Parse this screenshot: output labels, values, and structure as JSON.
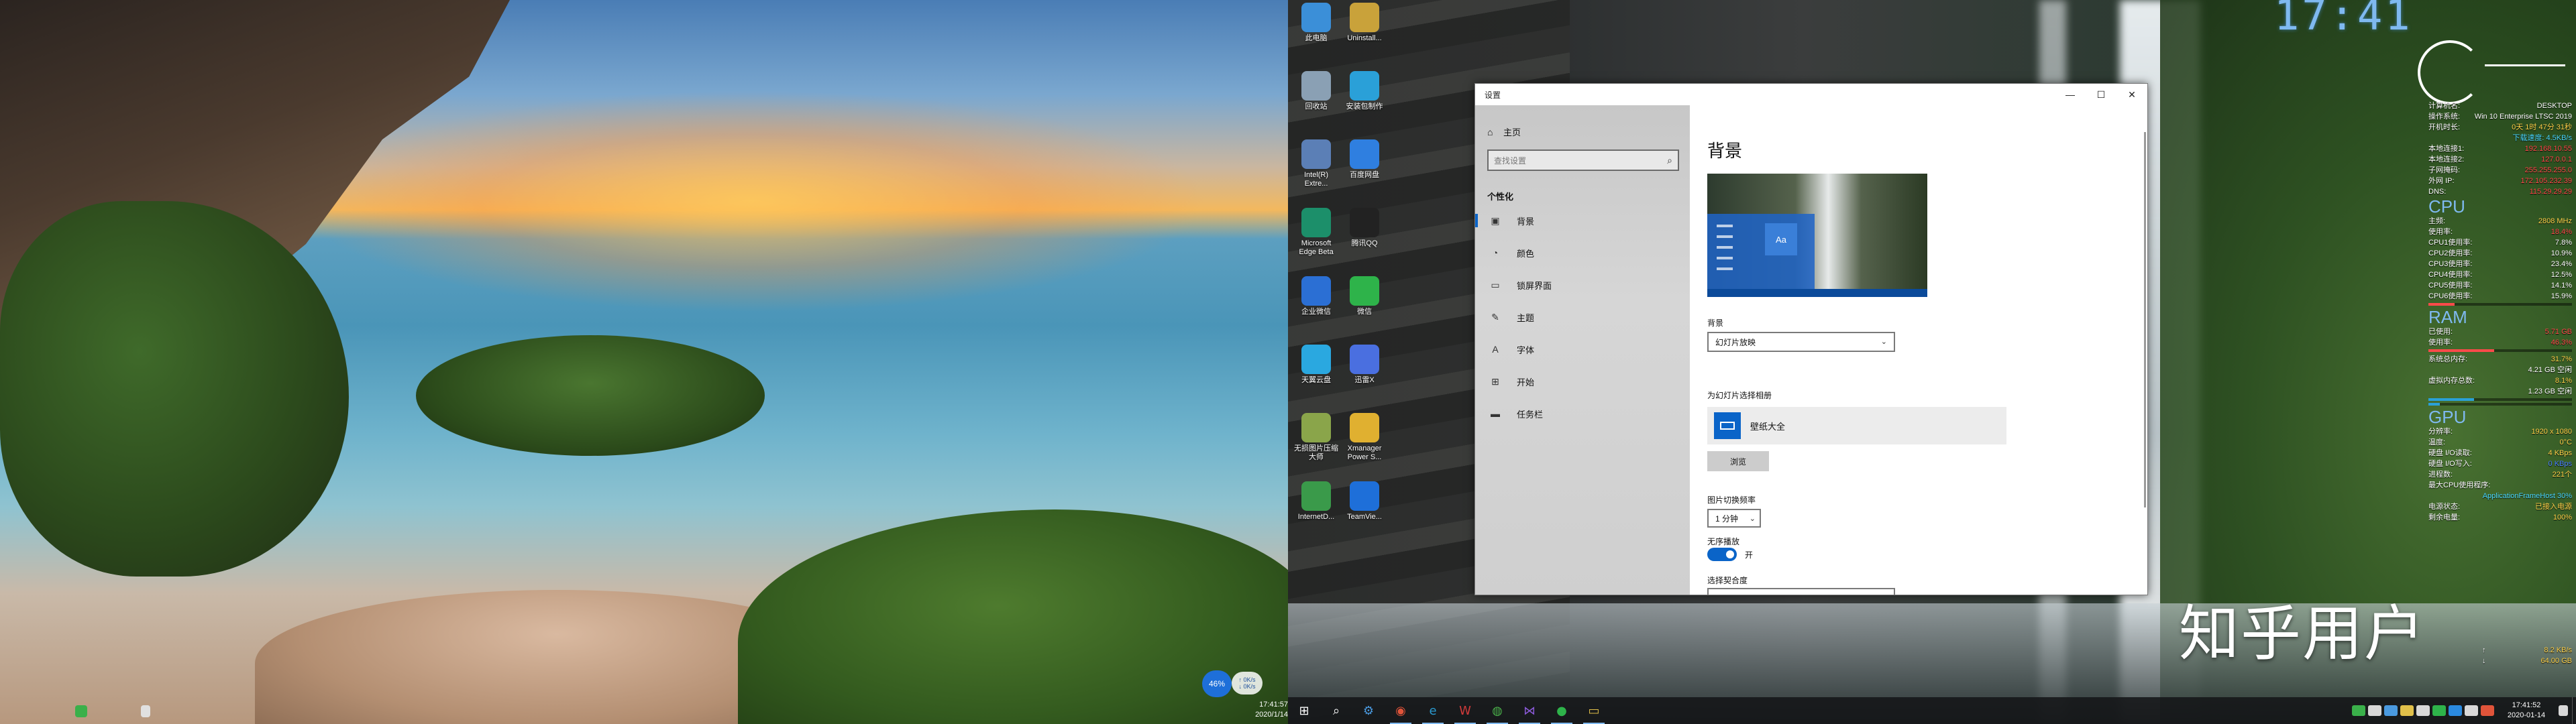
{
  "desktop": {
    "clock": "17:41",
    "watermark": "知乎用户"
  },
  "left_screen": {
    "speed_percent": "46%",
    "speed_up": "↑ 0K/s",
    "speed_down": "↓ 0K/s",
    "clock_time": "17:41:57",
    "clock_date": "2020/1/14"
  },
  "desktop_icons": [
    {
      "label": "此电脑",
      "icon": "computer-icon",
      "color": "#3b8fd8"
    },
    {
      "label": "Uninstall...",
      "icon": "uninstall-icon",
      "color": "#c9a23a"
    },
    {
      "label": "回收站",
      "icon": "recycle-bin-icon",
      "color": "#8aa0b4"
    },
    {
      "label": "安装包制作",
      "icon": "package-icon",
      "color": "#2aa0d8"
    },
    {
      "label": "Intel(R) Extre...",
      "icon": "intel-icon",
      "color": "#5b7fb6"
    },
    {
      "label": "百度网盘",
      "icon": "baidu-netdisk-icon",
      "color": "#2f7fe0"
    },
    {
      "label": "Microsoft Edge Beta",
      "icon": "edge-icon",
      "color": "#1c8f6a"
    },
    {
      "label": "腾讯QQ",
      "icon": "qq-icon",
      "color": "#222222"
    },
    {
      "label": "企业微信",
      "icon": "wecom-icon",
      "color": "#2b6fd4"
    },
    {
      "label": "微信",
      "icon": "wechat-icon",
      "color": "#2eb34a"
    },
    {
      "label": "天翼云盘",
      "icon": "cloud-drive-icon",
      "color": "#2aa8e0"
    },
    {
      "label": "迅雷X",
      "icon": "xunlei-icon",
      "color": "#4a6fe0"
    },
    {
      "label": "无损图片压缩大师",
      "icon": "image-compress-icon",
      "color": "#8aa54a"
    },
    {
      "label": "Xmanager Power S...",
      "icon": "xmanager-icon",
      "color": "#e0b030"
    },
    {
      "label": "InternetD...",
      "icon": "internet-download-icon",
      "color": "#3a9a4a"
    },
    {
      "label": "TeamVie...",
      "icon": "teamviewer-icon",
      "color": "#1e6fd9"
    }
  ],
  "settings": {
    "window_title": "设置",
    "nav_home": "主页",
    "search_placeholder": "查找设置",
    "section": "个性化",
    "nav_items": [
      {
        "label": "背景",
        "icon": "picture-icon"
      },
      {
        "label": "颜色",
        "icon": "palette-icon"
      },
      {
        "label": "锁屏界面",
        "icon": "lock-screen-icon"
      },
      {
        "label": "主题",
        "icon": "brush-icon"
      },
      {
        "label": "字体",
        "icon": "font-icon"
      },
      {
        "label": "开始",
        "icon": "start-icon"
      },
      {
        "label": "任务栏",
        "icon": "taskbar-icon"
      }
    ],
    "page_title": "背景",
    "preview_tile": "Aa",
    "background_label": "背景",
    "background_value": "幻灯片放映",
    "album_label": "为幻灯片选择相册",
    "album_name": "壁纸大全",
    "browse": "浏览",
    "interval_label": "图片切换频率",
    "interval_value": "1 分钟",
    "shuffle_label": "无序播放",
    "shuffle_state": "开",
    "fit_label": "选择契合度"
  },
  "sysmon": {
    "rows": [
      {
        "k": "计算机名:",
        "v": "DESKTOP",
        "c": "#ffffff"
      },
      {
        "k": "操作系统:",
        "v": "Win 10 Enterprise LTSC 2019",
        "c": "#ffffff"
      },
      {
        "k": "开机时长:",
        "v": "0天 1时 47分 31秒",
        "c": "#ffd24a"
      },
      {
        "k": "",
        "v": "下载速度:   4.5KB/s",
        "c": "#4ad8ff"
      },
      {
        "k": "本地连接1:",
        "v": "192.168.10.55",
        "c": "#ff4a4a"
      },
      {
        "k": "本地连接2:",
        "v": "127.0.0.1",
        "c": "#ff4a4a"
      },
      {
        "k": "子网掩码:",
        "v": "255.255.255.0",
        "c": "#ff4a4a"
      },
      {
        "k": "外网 IP:",
        "v": "172.105.232.39",
        "c": "#ff4a4a"
      },
      {
        "k": "DNS:",
        "v": "115.29.29.29",
        "c": "#ff4a4a"
      }
    ],
    "cpu_label": "CPU",
    "cpu_rows": [
      {
        "k": "主频:",
        "v": "2808 MHz",
        "c": "#ffd24a"
      },
      {
        "k": "使用率:",
        "v": "18.4%",
        "c": "#ff4a4a"
      },
      {
        "k": "CPU1使用率:",
        "v": "7.8%",
        "c": "#ffffff"
      },
      {
        "k": "CPU2使用率:",
        "v": "10.9%",
        "c": "#ffffff"
      },
      {
        "k": "CPU3使用率:",
        "v": "23.4%",
        "c": "#ffffff"
      },
      {
        "k": "CPU4使用率:",
        "v": "12.5%",
        "c": "#ffffff"
      },
      {
        "k": "CPU5使用率:",
        "v": "14.1%",
        "c": "#ffffff"
      },
      {
        "k": "CPU6使用率:",
        "v": "15.9%",
        "c": "#ffffff"
      }
    ],
    "ram_label": "RAM",
    "ram_rows": [
      {
        "k": "已使用:",
        "v": "5.71 GB",
        "c": "#ff4a4a"
      },
      {
        "k": "使用率:",
        "v": "46.3%",
        "c": "#ff4a4a"
      }
    ],
    "mem_rows": [
      {
        "k": "系统总内存:",
        "v": "31.7%",
        "c": "#ffd24a"
      },
      {
        "k": "",
        "v": "4.21 GB 空闲",
        "c": "#ffffff"
      },
      {
        "k": "虚拟内存总数:",
        "v": "8.1%",
        "c": "#ffd24a"
      },
      {
        "k": "",
        "v": "1.23 GB 空闲",
        "c": "#ffffff"
      }
    ],
    "gpu_label": "GPU",
    "gpu_rows": [
      {
        "k": "分辨率:",
        "v": "1920 x 1080",
        "c": "#ffd24a"
      },
      {
        "k": "温度:",
        "v": "0°C",
        "c": "#ffd24a"
      },
      {
        "k": "硬盘 I/O读取:",
        "v": "4 KBps",
        "c": "#ffd24a"
      },
      {
        "k": "硬盘 I/O写入:",
        "v": "0 KBps",
        "c": "#4a7fff"
      },
      {
        "k": "进程数:",
        "v": "221个",
        "c": "#ffd24a"
      },
      {
        "k": "最大CPU使用程序:",
        "v": "",
        "c": "#ffffff"
      },
      {
        "k": "",
        "v": "ApplicationFrameHost 30%",
        "c": "#4ad8ff"
      },
      {
        "k": "电源状态:",
        "v": "已接入电源",
        "c": "#ffd24a"
      },
      {
        "k": "剩余电量:",
        "v": "100%",
        "c": "#ffd24a"
      }
    ],
    "bars": [
      0.18,
      0.46,
      0.32,
      0.08
    ],
    "net_up": "8.2 KB/s",
    "net_down": "64.00 GB"
  },
  "taskbar": {
    "apps": [
      {
        "name": "start-button",
        "glyph": "⊞",
        "color": "#ffffff"
      },
      {
        "name": "search-button",
        "glyph": "⌕",
        "color": "#ffffff"
      },
      {
        "name": "settings-app",
        "glyph": "⚙",
        "color": "#4a9ae0"
      },
      {
        "name": "chrome-app",
        "glyph": "◉",
        "color": "#e0543a"
      },
      {
        "name": "edge-app",
        "glyph": "e",
        "color": "#2a9ad0"
      },
      {
        "name": "wps-app",
        "glyph": "W",
        "color": "#d03a3a"
      },
      {
        "name": "browser-app",
        "glyph": "◍",
        "color": "#4ab04a"
      },
      {
        "name": "vs-app",
        "glyph": "⋈",
        "color": "#8a5ad8"
      },
      {
        "name": "wechat-app",
        "glyph": "●",
        "color": "#2eb34a"
      },
      {
        "name": "explorer-app",
        "glyph": "▭",
        "color": "#e0c04a"
      }
    ],
    "tray_time": "17:41:52",
    "tray_date": "2020-01-14"
  }
}
